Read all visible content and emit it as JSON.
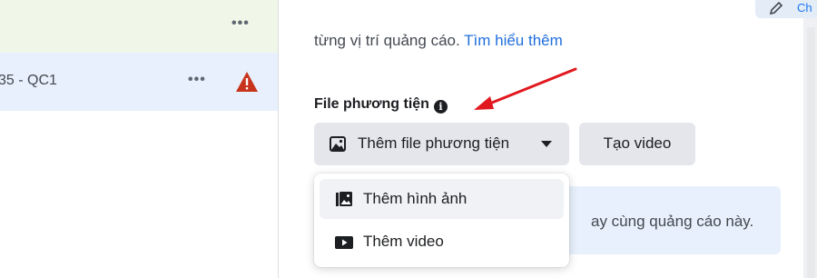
{
  "left_list": {
    "rows": [
      {
        "label": "",
        "menu_dots": "•••"
      },
      {
        "label": "35 - QC1",
        "menu_dots": "•••",
        "status_icon": "warning-icon"
      }
    ]
  },
  "top_right_button": {
    "label": "Ch",
    "icon": "pencil-icon"
  },
  "placement": {
    "description": "từng vị trí quảng cáo.",
    "learn_more": "Tìm hiểu thêm"
  },
  "media": {
    "title": "File phương tiện",
    "info_icon": "i",
    "add_media_label": "Thêm file phương tiện",
    "create_video_label": "Tạo video"
  },
  "dropdown": {
    "items": [
      {
        "label": "Thêm hình ảnh",
        "icon": "image-icon"
      },
      {
        "label": "Thêm video",
        "icon": "video-icon"
      }
    ]
  },
  "notice": {
    "text": "ay cùng quảng cáo này."
  },
  "colors": {
    "link": "#216fdb",
    "annotation_arrow": "#e0191f",
    "selected_row": "#e7f0fc",
    "warning": "#c8341b"
  }
}
